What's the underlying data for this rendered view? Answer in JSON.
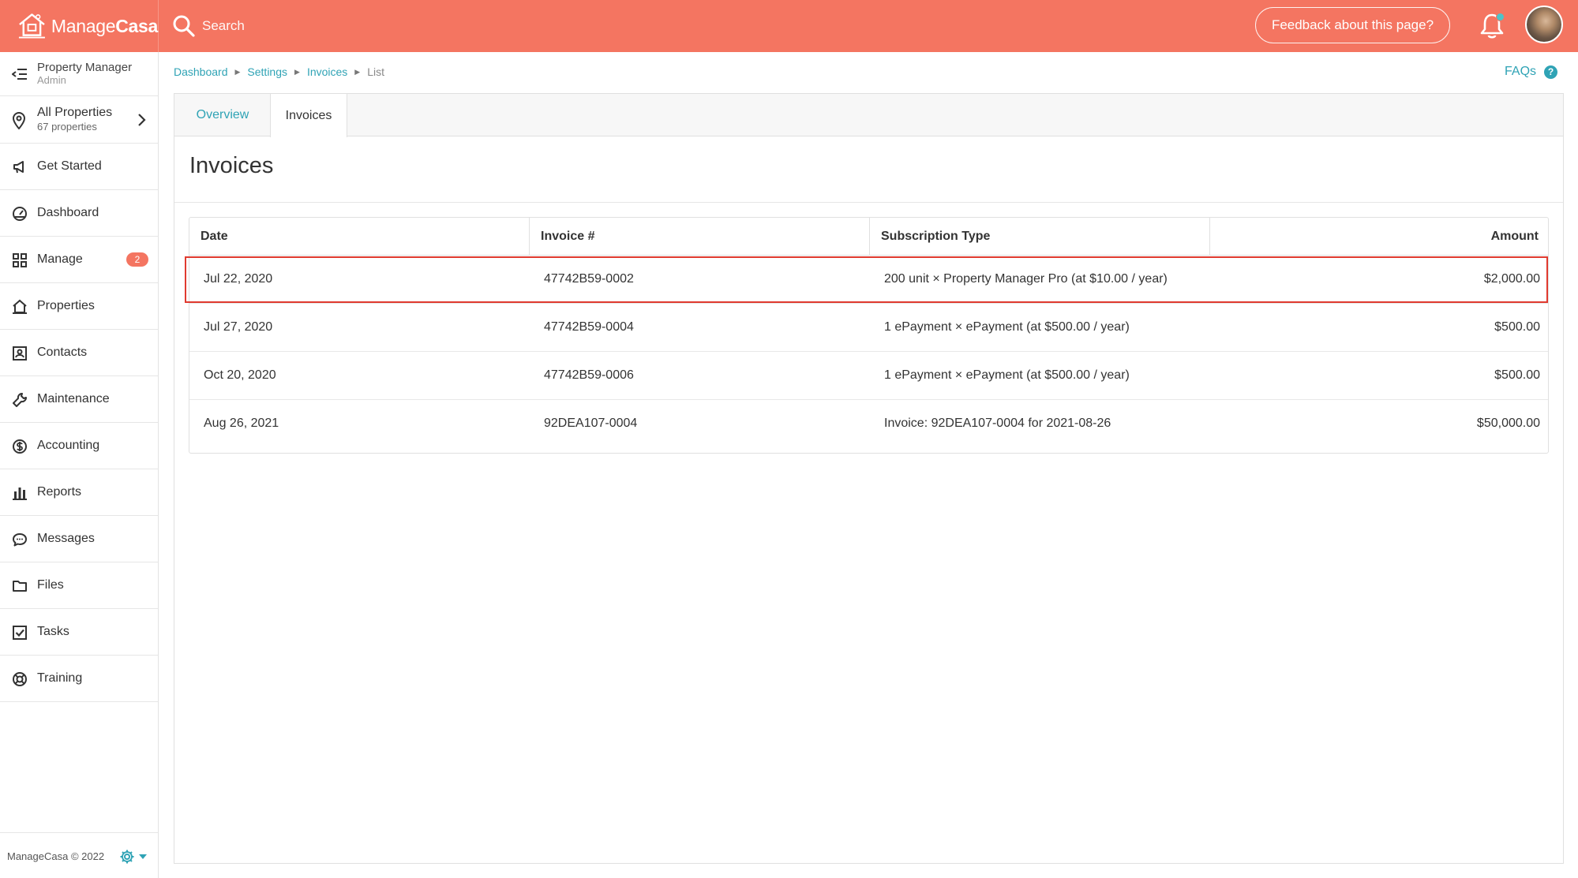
{
  "app": {
    "brand_part1": "Manage",
    "brand_part2": "Casa",
    "search_placeholder": "Search",
    "feedback_label": "Feedback about this page?"
  },
  "sidebar": {
    "role_title": "Property Manager",
    "role_subtitle": "Admin",
    "properties_title": "All Properties",
    "properties_count": "67 properties",
    "items": [
      {
        "label": "Get Started",
        "icon": "megaphone-icon"
      },
      {
        "label": "Dashboard",
        "icon": "gauge-icon"
      },
      {
        "label": "Manage",
        "icon": "grid-icon",
        "badge": "2"
      },
      {
        "label": "Properties",
        "icon": "house-icon"
      },
      {
        "label": "Contacts",
        "icon": "contact-card-icon"
      },
      {
        "label": "Maintenance",
        "icon": "wrench-icon"
      },
      {
        "label": "Accounting",
        "icon": "dollar-icon"
      },
      {
        "label": "Reports",
        "icon": "bar-chart-icon"
      },
      {
        "label": "Messages",
        "icon": "chat-bubble-icon"
      },
      {
        "label": "Files",
        "icon": "folder-icon"
      },
      {
        "label": "Tasks",
        "icon": "checkbox-icon"
      },
      {
        "label": "Training",
        "icon": "lifebuoy-icon"
      }
    ],
    "footer": "ManageCasa © 2022"
  },
  "breadcrumb": {
    "items": [
      "Dashboard",
      "Settings",
      "Invoices"
    ],
    "current": "List"
  },
  "faqs_label": "FAQs",
  "faqs_icon": "?",
  "tabs": {
    "overview": "Overview",
    "invoices": "Invoices",
    "active": "Invoices"
  },
  "page_title": "Invoices",
  "table": {
    "headers": [
      "Date",
      "Invoice #",
      "Subscription Type",
      "Amount"
    ],
    "rows": [
      {
        "date": "Jul 22, 2020",
        "invoice": "47742B59-0002",
        "type": "200 unit × Property Manager Pro (at $10.00 / year)",
        "amount": "$2,000.00"
      },
      {
        "date": "Jul 27, 2020",
        "invoice": "47742B59-0004",
        "type": "1 ePayment × ePayment (at $500.00 / year)",
        "amount": "$500.00"
      },
      {
        "date": "Oct 20, 2020",
        "invoice": "47742B59-0006",
        "type": "1 ePayment × ePayment (at $500.00 / year)",
        "amount": "$500.00"
      },
      {
        "date": "Aug 26, 2021",
        "invoice": "92DEA107-0004",
        "type": "Invoice: 92DEA107-0004 for 2021-08-26",
        "amount": "$50,000.00"
      }
    ]
  },
  "colors": {
    "brand": "#f47561",
    "accent": "#2fa3b5",
    "highlight": "#e03a2f"
  }
}
